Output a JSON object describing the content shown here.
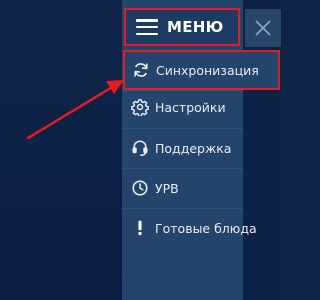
{
  "menu": {
    "title": "МЕНЮ",
    "items": [
      {
        "label": "Синхронизация",
        "icon": "sync-icon",
        "highlighted": true
      },
      {
        "label": "Настройки",
        "icon": "gear-icon",
        "highlighted": false
      },
      {
        "label": "Поддержка",
        "icon": "headset-icon",
        "highlighted": false
      },
      {
        "label": "УРВ",
        "icon": "clock-icon",
        "highlighted": false
      },
      {
        "label": "Готовые блюда",
        "icon": "exclamation-icon",
        "highlighted": false
      }
    ]
  },
  "colors": {
    "background": "#0d2347",
    "menu_panel": "#23446b",
    "highlight_border": "#e31b23",
    "annotation_arrow": "#e31b23",
    "text": "#ffffff"
  },
  "close_button": {
    "icon": "close-icon"
  },
  "annotation": {
    "type": "arrow",
    "points_to": "menu-item-sync"
  }
}
